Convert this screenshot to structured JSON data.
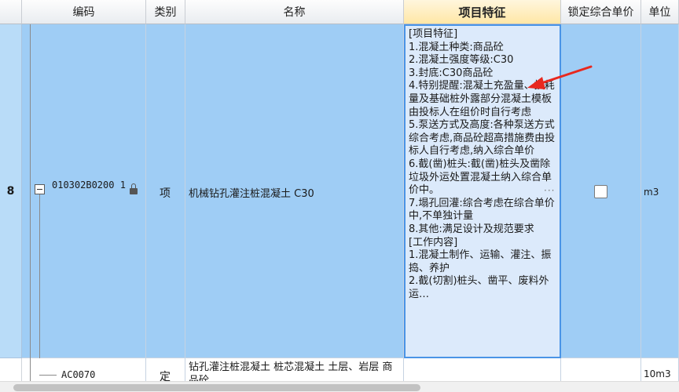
{
  "columns": {
    "code": "编码",
    "type": "类别",
    "name": "名称",
    "feature": "项目特征",
    "lock_price": "锁定综合单价",
    "unit": "单位"
  },
  "rows": [
    {
      "num": "8",
      "code": "010302B0200 1",
      "type": "项",
      "name": "机械钻孔灌注桩混凝土 C30",
      "unit": "m3",
      "locked": false,
      "feature_lines": [
        "[项目特征]",
        "1.混凝土种类:商品砼",
        "2.混凝土强度等级:C30",
        "3.封底:C30商品砼",
        "4.特别提醒:混凝土充盈量、损耗量及基础桩外露部分混凝土模板由投标人在组价时自行考虑",
        "5.泵送方式及高度:各种泵送方式综合考虑,商品砼超高措施费由投标人自行考虑,纳入综合单价",
        "6.截(凿)桩头:截(凿)桩头及凿除垃圾外运处置混凝土纳入综合单价中。",
        "7.塌孔回灌:综合考虑在综合单价中,不单独计量",
        "8.其他:满足设计及规范要求",
        "[工作内容]",
        "1.混凝土制作、运输、灌注、振捣、养护",
        "2.截(切割)桩头、凿平、废料外运…"
      ]
    },
    {
      "num": "",
      "code": "AC0070",
      "type": "定",
      "name": "钻孔灌注桩混凝土 桩芯混凝土 土层、岩层 商品砼",
      "unit": "10m3"
    }
  ],
  "icons": {
    "lock": "lock-icon",
    "expand": "collapse-minus-icon",
    "arrow": "red-annotation-arrow"
  },
  "colors": {
    "selected_row": "#9fcdf5",
    "active_cell": "#dceafb",
    "active_border": "#4a94e6",
    "arrow": "#e8281e"
  },
  "ellipsis": "···"
}
